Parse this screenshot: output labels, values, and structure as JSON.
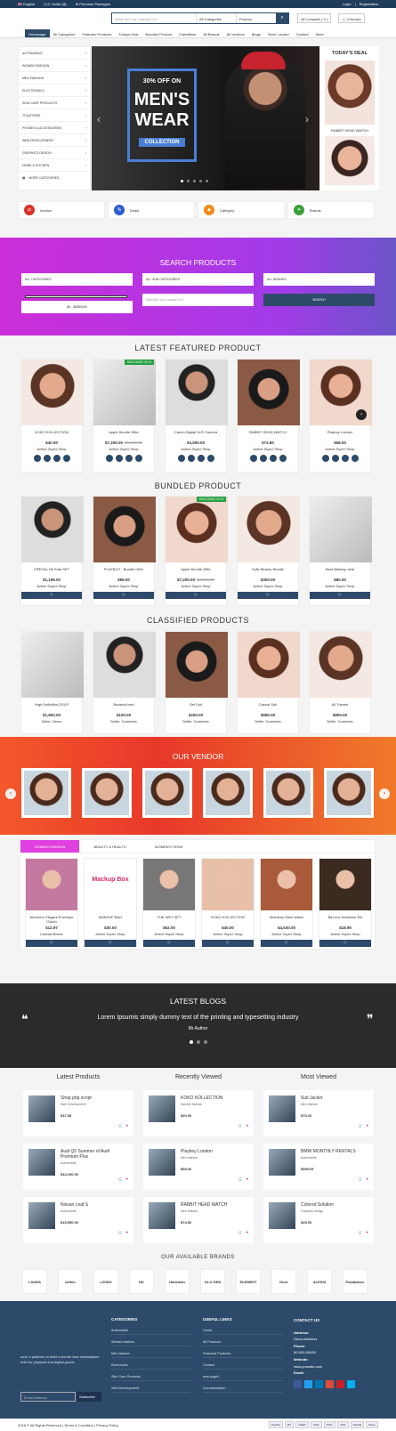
{
  "topbar": {
    "language": "English",
    "currency": "U.S. Dollar ($)",
    "premium": "Premium Packages",
    "login": "Login",
    "sep": "|",
    "register": "Registration"
  },
  "search": {
    "placeholder": "What Are You Looking For?",
    "category": "All Categories",
    "type": "Product",
    "compare": "All Compare ( 0 )",
    "cart": "0 item(s)"
  },
  "nav": [
    "Homepage",
    "All Categories",
    "Featured Products",
    "Todays Deal",
    "Bundled Product",
    "Classifieds",
    "All Brands",
    "All Vendors",
    "Blogs",
    "Store Locator",
    "Contact",
    "More"
  ],
  "categories": [
    "AUTOMOBILE",
    "WOMEN FASHION",
    "MEN FASHION",
    "ELECTRONICS",
    "SKIN CARE PRODUCTS",
    "TOILETRIES",
    "PHONES & ACCESSORIES",
    "WEB DEVELOPMENT",
    "GRAPHICS DESIGN",
    "HOME & KITCHEN"
  ],
  "more_categories": "MORE CATEGORIES",
  "banner": {
    "line1": "30% OFF ON",
    "line2": "MEN'S",
    "line3": "WEAR",
    "line4": "COLLECTION"
  },
  "todays_deal": {
    "title": "TODAY'S DEAL",
    "item": "RABBIT HEAD WATCH"
  },
  "quick": [
    {
      "label": "Auction",
      "color": "#d9302a"
    },
    {
      "label": "Deals",
      "color": "#2a5ccf"
    },
    {
      "label": "Category",
      "color": "#f08a1a"
    },
    {
      "label": "Brands",
      "color": "#3aa23a"
    }
  ],
  "search_products": {
    "title": "SEARCH PRODUCTS",
    "cat": "ALL CATEGORIES",
    "sub": "ALL SUB CATEGORIES",
    "brand": "ALL BRANDS",
    "range": "$0 - $4880000",
    "placeholder": "What Are You Looking For?",
    "button": "SEARCH"
  },
  "featured": {
    "title": "LATEST FEATURED PRODUCT",
    "items": [
      {
        "name": "KOKO KOLLECTION",
        "price": "$40.00",
        "old": "",
        "shop": "Active Super Shop",
        "badge": ""
      },
      {
        "name": "Apple Bundle Offer",
        "price": "$7,200.00",
        "old": "$8,000.00",
        "shop": "Active Super Shop",
        "badge": "DISCOUNT 10 %"
      },
      {
        "name": "Canon Digital SLR Camera",
        "price": "$3,500.00",
        "old": "",
        "shop": "Active Super Shop",
        "badge": ""
      },
      {
        "name": "RABBIT HEAD WATCH",
        "price": "$74.80",
        "old": "",
        "shop": "Active Super Shop",
        "badge": ""
      },
      {
        "name": "Playboy London",
        "price": "$68.00",
        "old": "",
        "shop": "Active Super Shop",
        "badge": ""
      }
    ]
  },
  "bundled": {
    "title": "BUNDLED PRODUCT",
    "items": [
      {
        "name": "CRESAL Hit Sofa SET",
        "price": "$1,199.00",
        "old": "",
        "shop": "Active Super Shop",
        "badge": ""
      },
      {
        "name": "PLAYBOY - Bundle Offer",
        "price": "$99.00",
        "old": "",
        "shop": "Active Super Shop",
        "badge": ""
      },
      {
        "name": "Apple Bundle Offer",
        "price": "$7,200.00",
        "old": "$8,000.00",
        "shop": "Active Super Shop",
        "badge": "DISCOUNT 10 %"
      },
      {
        "name": "Kylie Beauty Bundle",
        "price": "$300.00",
        "old": "",
        "shop": "Active Super Shop",
        "badge": ""
      },
      {
        "name": "Best Makeup deal",
        "price": "$80.00",
        "old": "",
        "shop": "Active Super Shop",
        "badge": ""
      }
    ]
  },
  "classified": {
    "title": "CLASSIFIED PRODUCTS",
    "items": [
      {
        "name": "High Definition DSLR",
        "price": "$1,800.00",
        "shop": "Seller: Demo"
      },
      {
        "name": "Boosted heel",
        "price": "$100.00",
        "shop": "Seller: Customer"
      },
      {
        "name": "Set Suit",
        "price": "$250.00",
        "shop": "Seller: Customer"
      },
      {
        "name": "Casual Suit",
        "price": "$580.00",
        "shop": "Seller: Customer"
      },
      {
        "name": "All Travels",
        "price": "$850.00",
        "shop": "Seller: Customer"
      }
    ]
  },
  "vendor": {
    "title": "OUR VENDOR"
  },
  "tabs": [
    "WOMEN FASHION",
    "BEAUTY & HEALTH",
    "WOMEN'S SHOE"
  ],
  "tab_items": [
    {
      "name": "Women's Elegant Envelope Clutch",
      "price": "$12.97",
      "shop": "Lavinia Mckee"
    },
    {
      "name": "MAKEUP BAG",
      "price": "$30.00",
      "shop": "Active Super Shop"
    },
    {
      "name": "THE WET SET",
      "price": "$62.00",
      "shop": "Active Super Shop"
    },
    {
      "name": "KOKO KOLLECTION",
      "price": "$40.00",
      "shop": "Active Super Shop"
    },
    {
      "name": "Stainless Steel Watch",
      "price": "$4,530.00",
      "shop": "Active Super Shop"
    },
    {
      "name": "BirLove Necklace Set",
      "price": "$18.95",
      "shop": "Active Super Shop"
    }
  ],
  "makeup_box": "Mackup Box",
  "blog": {
    "title": "LATEST BLOGS",
    "text": "Lorem Ipsumis simply dummy text of the printing and typesetting industry",
    "author": "Mr Author"
  },
  "lists": [
    {
      "title": "Latest Products",
      "items": [
        {
          "name": "Shop php script",
          "cat": "Web Development",
          "price": "$37.50"
        },
        {
          "name": "Audi Q5 Summer of Audi Premium Plus",
          "cat": "Automobile",
          "price": "$44,190.00"
        },
        {
          "name": "Nissan Leaf S",
          "cat": "Automobile",
          "price": "$15,550.00"
        }
      ]
    },
    {
      "title": "Recently Viewed",
      "items": [
        {
          "name": "KOKO KOLLECTION",
          "cat": "Women fashion",
          "price": "$40.00"
        },
        {
          "name": "Playboy London",
          "cat": "Men fashion",
          "price": "$68.00"
        },
        {
          "name": "RABBIT HEAD WATCH",
          "cat": "Men fashion",
          "price": "$74.80"
        }
      ]
    },
    {
      "title": "Most Viewed",
      "items": [
        {
          "name": "Suit Jacket",
          "cat": "Men fashion",
          "price": "$79.20"
        },
        {
          "name": "BMW MONTHLY RENTALS",
          "cat": "Automobile",
          "price": "$909.09"
        },
        {
          "name": "Colored Solution",
          "cat": "Graphics design",
          "price": "$25.00"
        }
      ]
    }
  ],
  "brands_title": "OUR AVAILABLE BRANDS",
  "brands": [
    "LAURA",
    "belkin",
    "LIVING",
    "HK",
    "Hackman",
    "GLO GEN",
    "ELEMENT",
    "Dixie",
    "ALESSI",
    "Pasabahce"
  ],
  "footer": {
    "about": "such a platform to build a border less marketplace both for physical and digital goods.",
    "email_placeholder": "Email Address",
    "subscribe": "Subscribe",
    "cat_title": "CATEGORIES",
    "cats": [
      "Automobile",
      "Women fashion",
      "Men fashion",
      "Electronics",
      "Skin Care Products",
      "Web Development"
    ],
    "links_title": "USEFUL LINKS",
    "links": [
      "Home",
      "All Products",
      "Featured Products",
      "Contact",
      "new page1",
      "Documentation"
    ],
    "contact_title": "CONTACT US",
    "address_label": "Address:",
    "address": "Demo Address",
    "phone_label": "Phone:",
    "phone": "00-000-00000",
    "website_label": "Website:",
    "website": "www.yoursite.com",
    "email_label": "Email:",
    "copyright": "2018 © All Rights Reserved",
    "terms": "Terms & Condition",
    "privacy": "Privacy Policy",
    "payments": [
      "PayPal",
      "MC",
      "AMEX",
      "VISA",
      "DISC",
      "VISA",
      "PayPal",
      "Stripe"
    ]
  }
}
